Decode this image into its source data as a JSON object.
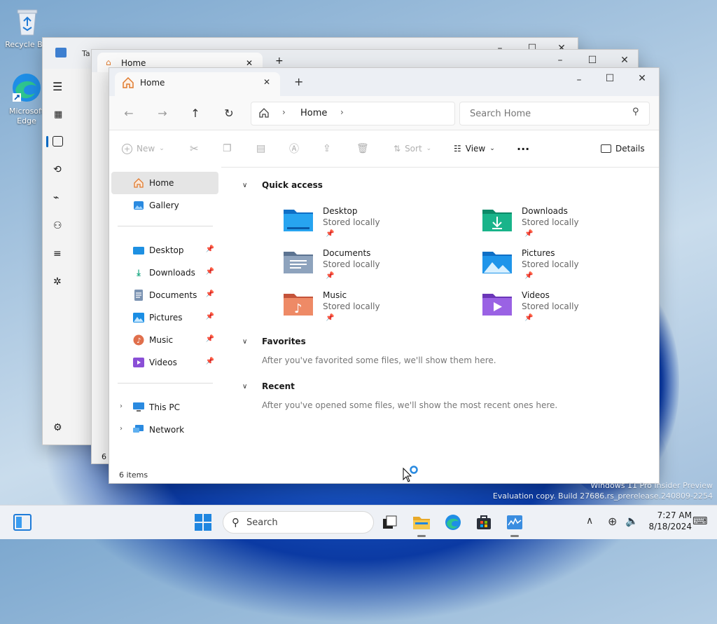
{
  "desktop": {
    "icons": [
      {
        "label": "Recycle Bin"
      },
      {
        "label": "Microsoft Edge"
      }
    ],
    "watermark_line1": "Windows 11 Pro Insider Preview",
    "watermark_line2": "Evaluation copy. Build 27686.rs_prerelease.240809-2254"
  },
  "back_windows": {
    "task_manager_title": "Ta",
    "task_manager_status": "",
    "explorer2_tab": "Home",
    "explorer2_status": "6 i"
  },
  "explorer": {
    "tab_title": "Home",
    "breadcrumb": [
      "Home"
    ],
    "search_placeholder": "Search Home",
    "toolbar": {
      "new_label": "New",
      "sort_label": "Sort",
      "view_label": "View",
      "details_label": "Details"
    },
    "sidebar": {
      "top": [
        {
          "label": "Home",
          "icon": "home-icon",
          "selected": true
        },
        {
          "label": "Gallery",
          "icon": "gallery-icon"
        }
      ],
      "pinned": [
        {
          "label": "Desktop",
          "icon": "desktop-folder-icon"
        },
        {
          "label": "Downloads",
          "icon": "downloads-icon"
        },
        {
          "label": "Documents",
          "icon": "documents-icon"
        },
        {
          "label": "Pictures",
          "icon": "pictures-icon"
        },
        {
          "label": "Music",
          "icon": "music-icon"
        },
        {
          "label": "Videos",
          "icon": "videos-icon"
        }
      ],
      "devices": [
        {
          "label": "This PC",
          "icon": "pc-icon"
        },
        {
          "label": "Network",
          "icon": "network-icon"
        }
      ]
    },
    "sections": {
      "quick_access": "Quick access",
      "favorites": "Favorites",
      "favorites_empty": "After you've favorited some files, we'll show them here.",
      "recent": "Recent",
      "recent_empty": "After you've opened some files, we'll show the most recent ones here."
    },
    "quick_access": [
      {
        "name": "Desktop",
        "sub": "Stored locally",
        "color": "#1a8fe0"
      },
      {
        "name": "Downloads",
        "sub": "Stored locally",
        "color": "#13a57f"
      },
      {
        "name": "Documents",
        "sub": "Stored locally",
        "color": "#6e89a8"
      },
      {
        "name": "Pictures",
        "sub": "Stored locally",
        "color": "#1b8ee4"
      },
      {
        "name": "Music",
        "sub": "Stored locally",
        "color": "#e06f4c"
      },
      {
        "name": "Videos",
        "sub": "Stored locally",
        "color": "#8a4fd6"
      }
    ],
    "status": "6 items"
  },
  "taskbar": {
    "search_label": "Search",
    "time": "7:27 AM",
    "date": "8/18/2024"
  },
  "colors": {
    "accent": "#0067c0",
    "folder_yellow": "#f2c04a"
  }
}
